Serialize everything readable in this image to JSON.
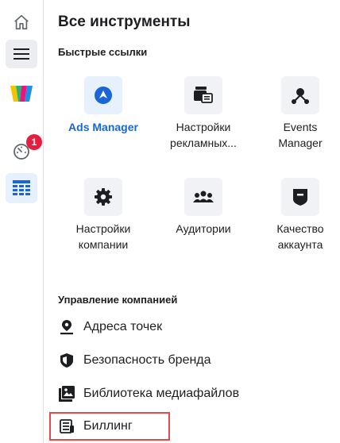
{
  "title": "Все инструменты",
  "quick_links": {
    "heading": "Быстрые ссылки",
    "items": [
      {
        "label": "Ads Manager",
        "icon": "ads-manager-icon"
      },
      {
        "label": "Настройки рекламных...",
        "icon": "ad-settings-icon"
      },
      {
        "label": "Events Manager",
        "icon": "events-manager-icon"
      },
      {
        "label": "Настройки компании",
        "icon": "gear-icon"
      },
      {
        "label": "Аудитории",
        "icon": "audiences-icon"
      },
      {
        "label": "Качество аккаунта",
        "icon": "shield-icon"
      }
    ]
  },
  "company": {
    "heading": "Управление компанией",
    "items": [
      {
        "label": "Адреса точек",
        "icon": "location-icon"
      },
      {
        "label": "Безопасность бренда",
        "icon": "shield-check-icon"
      },
      {
        "label": "Библиотека медиафайлов",
        "icon": "media-library-icon"
      },
      {
        "label": "Биллинг",
        "icon": "billing-icon"
      }
    ]
  },
  "sidebar": {
    "notification_count": "1",
    "items": [
      "home-icon",
      "menu-icon",
      "logo",
      "speedometer-icon",
      "table-icon"
    ]
  },
  "colors": {
    "accent": "#1a66d6",
    "highlight": "#e24b4b",
    "badge": "#e41e3f"
  }
}
